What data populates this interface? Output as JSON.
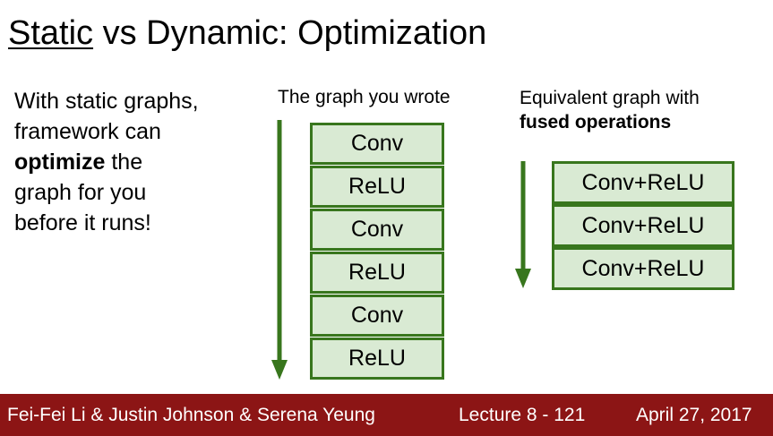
{
  "title": {
    "part1": "Static",
    "part2": " vs Dynamic: Optimization"
  },
  "intro": {
    "line1": "With static graphs,",
    "line2": "framework can",
    "bold": "optimize",
    "line3_rest": " the",
    "line4": "graph for you",
    "line5": "before it runs!"
  },
  "left_graph": {
    "caption": "The graph you wrote",
    "nodes": [
      "Conv",
      "ReLU",
      "Conv",
      "ReLU",
      "Conv",
      "ReLU"
    ]
  },
  "right_graph": {
    "caption_line1": "Equivalent graph with",
    "caption_bold": "fused operations",
    "nodes": [
      "Conv+ReLU",
      "Conv+ReLU",
      "Conv+ReLU"
    ]
  },
  "footer": {
    "authors": "Fei-Fei Li & Justin Johnson & Serena Yeung",
    "lecture": "Lecture 8 - 121",
    "date": "April 27, 2017"
  },
  "colors": {
    "node_fill": "#d9ead3",
    "node_border": "#38761d",
    "arrow": "#38761d",
    "footer_bg": "#8c1515"
  }
}
